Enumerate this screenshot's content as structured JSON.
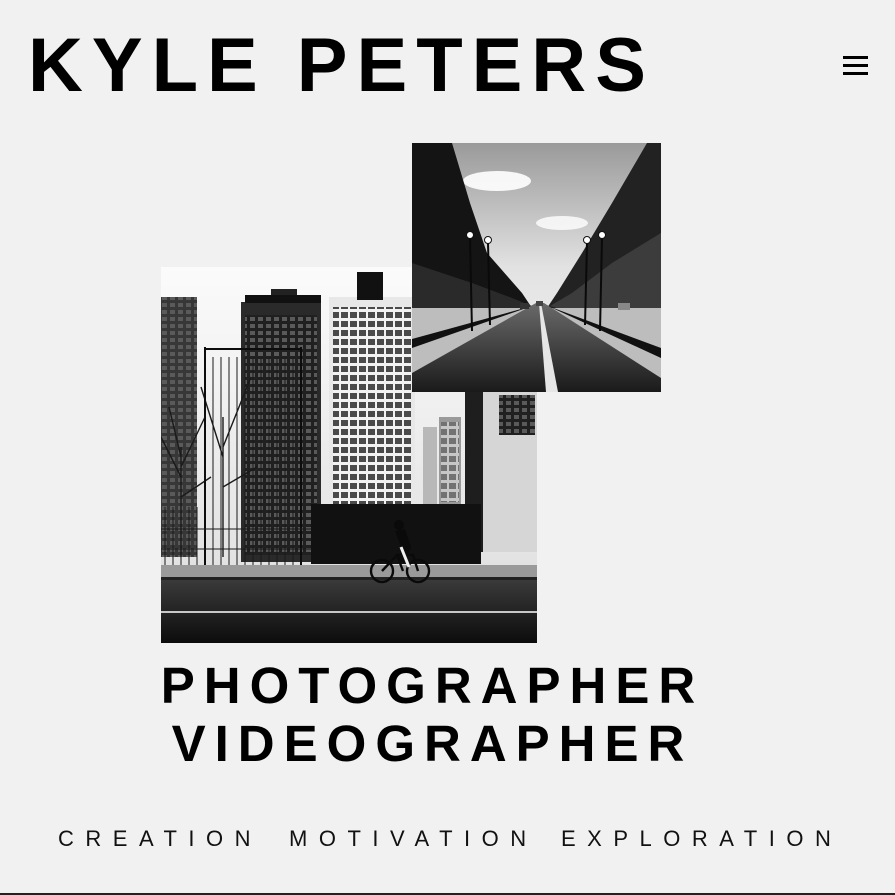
{
  "header": {
    "brand_name": "KYLE PETERS",
    "menu_icon": "hamburger-menu-icon"
  },
  "gallery": {
    "images": [
      {
        "name": "city street with cyclist",
        "style": "black-and-white"
      },
      {
        "name": "tree-lined road",
        "style": "black-and-white"
      }
    ]
  },
  "hero": {
    "roles": [
      "PHOTOGRAPHER",
      "VIDEOGRAPHER"
    ]
  },
  "values": [
    "CREATION",
    "MOTIVATION",
    "EXPLORATION"
  ],
  "colors": {
    "background": "#f1f1f1",
    "text": "#000000"
  }
}
